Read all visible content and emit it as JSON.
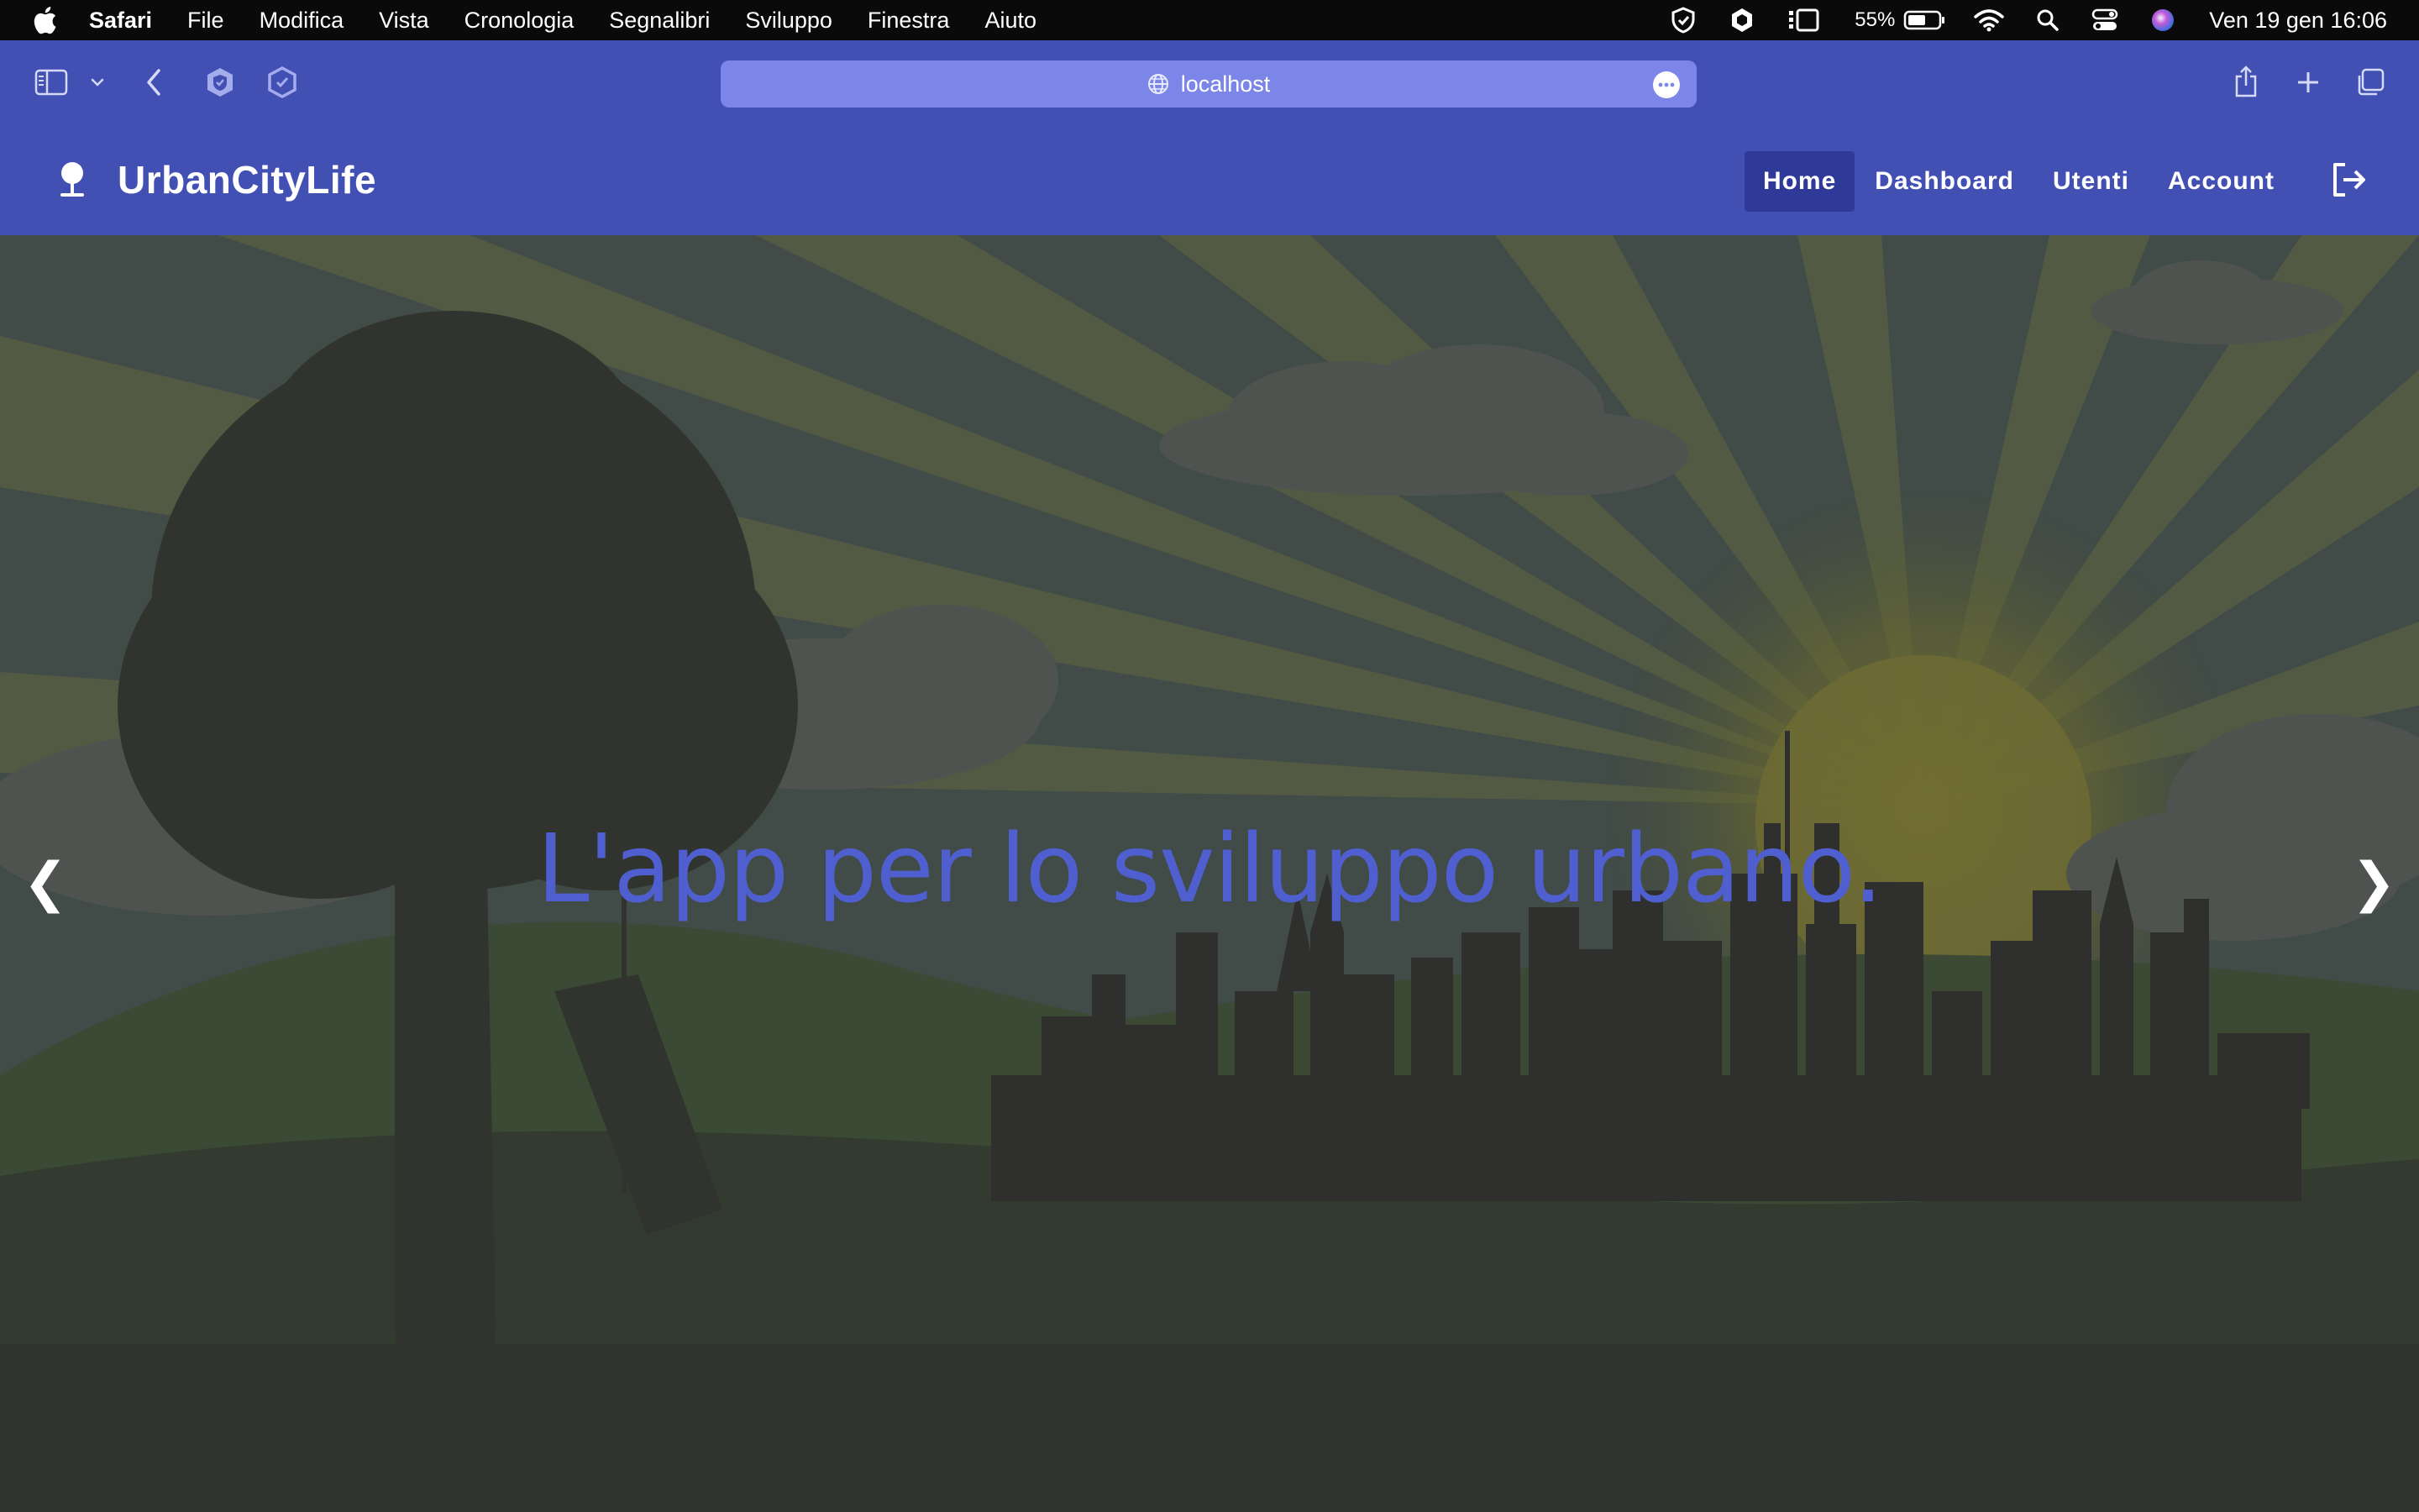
{
  "menubar": {
    "app_name": "Safari",
    "items": [
      "File",
      "Modifica",
      "Vista",
      "Cronologia",
      "Segnalibri",
      "Sviluppo",
      "Finestra",
      "Aiuto"
    ],
    "battery_percent": "55%",
    "clock": "Ven 19 gen  16:06"
  },
  "browser": {
    "url": "localhost"
  },
  "navbar": {
    "brand": "UrbanCityLife",
    "links": [
      {
        "label": "Home",
        "active": true
      },
      {
        "label": "Dashboard",
        "active": false
      },
      {
        "label": "Utenti",
        "active": false
      },
      {
        "label": "Account",
        "active": false
      }
    ]
  },
  "hero": {
    "title": "L'app per lo sviluppo urbano.",
    "prev_symbol": "❮",
    "next_symbol": "❯"
  },
  "colors": {
    "menubar_bg": "#0a0a0a",
    "brand_blue": "#4350b3",
    "url_bar": "#7c86e9",
    "nav_active": "#2f3a98",
    "hero_text": "#4f5fcf",
    "hero_overlay_ground": "#2f322f"
  },
  "icons": {
    "menubar_left": "apple-icon",
    "menubar_status": [
      "vpn-shield-icon",
      "chatgpt-icon",
      "stage-manager-icon",
      "battery-icon",
      "wifi-icon",
      "spotlight-search-icon",
      "control-center-icon",
      "siri-icon"
    ],
    "toolbar_left": [
      "sidebar-icon",
      "chevron-down-icon",
      "back-arrow-icon",
      "privacy-shield-icon",
      "shield-check-icon"
    ],
    "toolbar_right": [
      "share-icon",
      "new-tab-plus-icon",
      "tab-overview-icon"
    ],
    "navbar": [
      "tree-logo-icon",
      "logout-icon"
    ]
  }
}
